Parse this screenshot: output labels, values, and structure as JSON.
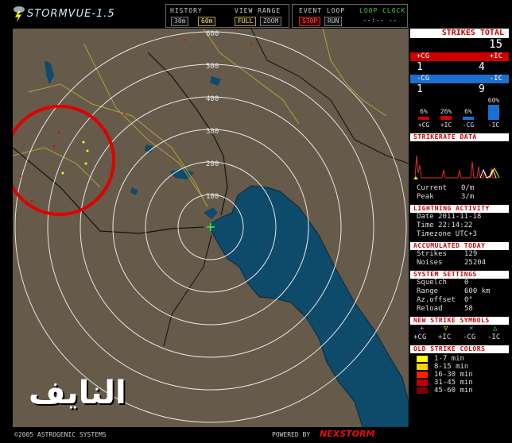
{
  "app": {
    "title": "STORMVUE-1.5"
  },
  "toolbar": {
    "history_label": "HISTORY",
    "history_opts": [
      "30m",
      "60m"
    ],
    "range_label": "VIEW RANGE",
    "range_opts": [
      "FULL",
      "ZOOM"
    ],
    "loop_label": "EVENT LOOP",
    "loop_opts": [
      "STOP",
      "RUN"
    ],
    "clock_label": "LOOP CLOCK",
    "clock_value": "--:-- --"
  },
  "map": {
    "range_labels": [
      "100",
      "200",
      "300",
      "400",
      "500",
      "600"
    ],
    "watermark": "النايف"
  },
  "strikes": {
    "total_label": "STRIKES TOTAL",
    "total": "15",
    "pos_cg_label": "+CG",
    "pos_ic_label": "+IC",
    "pos_cg": "1",
    "pos_ic": "4",
    "neg_cg_label": "-CG",
    "neg_ic_label": "-IC",
    "neg_cg": "1",
    "neg_ic": "9",
    "percents": [
      {
        "pct": "6%",
        "fraction": 0.067,
        "label": "+CG"
      },
      {
        "pct": "26%",
        "fraction": 0.267,
        "label": "+IC"
      },
      {
        "pct": "6%",
        "fraction": 0.067,
        "label": "-CG"
      },
      {
        "pct": "60%",
        "fraction": 0.6,
        "label": "-IC"
      }
    ]
  },
  "strikerate": {
    "title": "STRIKERATE DATA",
    "current_label": "Current",
    "current": "0/m",
    "peak_label": "Peak",
    "peak": "3/m"
  },
  "activity": {
    "title": "LIGHTNING ACTIVITY",
    "date_label": "Date",
    "date": "2011-11-18",
    "time_label": "Time",
    "time": "22:14:22",
    "tz_label": "Timezone",
    "tz": "UTC+3"
  },
  "accumulated": {
    "title": "ACCUMULATED TODAY",
    "strikes_label": "Strikes",
    "strikes": "129",
    "noises_label": "Noises",
    "noises": "25204"
  },
  "settings": {
    "title": "SYSTEM SETTINGS",
    "squelch_label": "Squelch",
    "squelch": "0",
    "range_label": "Range",
    "range": "600 km",
    "az_label": "Az.offset",
    "az": "0°",
    "reload_label": "Reload",
    "reload": "58"
  },
  "symbols": {
    "title": "NEW STRIKE SYMBOLS",
    "items": [
      "+CG",
      "+IC",
      "-CG",
      "-IC"
    ]
  },
  "old_colors": {
    "title": "OLD STRIKE COLORS",
    "items": [
      {
        "label": "1-7 min",
        "color": "#ffff00"
      },
      {
        "label": "8-15 min",
        "color": "#ffd000"
      },
      {
        "label": "16-30 min",
        "color": "#ff2000"
      },
      {
        "label": "31-45 min",
        "color": "#c00000"
      },
      {
        "label": "45-60 min",
        "color": "#800000"
      }
    ]
  },
  "footer": {
    "copyright": "©2005 ASTROGENIC SYSTEMS",
    "powered": "POWERED BY",
    "brand": "NEXSTORM"
  }
}
